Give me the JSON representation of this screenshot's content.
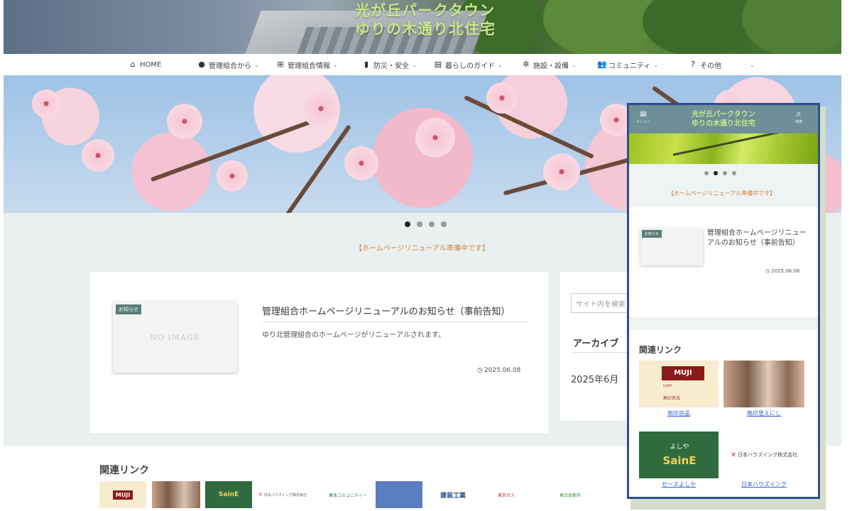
{
  "site": {
    "title_line1": "光が丘パークタウン",
    "title_line2": "ゆりの木通り北住宅"
  },
  "nav": {
    "items": [
      {
        "label": "HOME",
        "icon": "home-icon"
      },
      {
        "label": "管理組合から",
        "icon": "info-icon"
      },
      {
        "label": "管理組合情報",
        "icon": "sitemap-icon"
      },
      {
        "label": "防災・安全",
        "icon": "clipboard-icon"
      },
      {
        "label": "暮らしのガイド",
        "icon": "document-icon"
      },
      {
        "label": "施設・設備",
        "icon": "gear-icon"
      },
      {
        "label": "コミュニティ",
        "icon": "users-icon"
      },
      {
        "label": "その他",
        "icon": "question-icon"
      }
    ],
    "chevron": "⌄"
  },
  "notice": "【ホームページリニューアル準備中です】",
  "post": {
    "category": "お知らせ",
    "noimage": "NO IMAGE",
    "title": "管理組合ホームページリニューアルのお知らせ（事前告知）",
    "excerpt": "ゆり北管理組合のホームページがリニューアルされます。",
    "date": "2025.06.08"
  },
  "sidebar": {
    "search_placeholder": "サイト内を検索",
    "archive_heading": "アーカイブ",
    "archive_item": "2025年6月"
  },
  "links": {
    "heading": "関連リンク",
    "logos": [
      {
        "label": "MUJI"
      },
      {
        "label": ""
      },
      {
        "label": "SainE"
      },
      {
        "label": "日本ハウズイング株式会社"
      },
      {
        "label": "東急コミュニティー"
      },
      {
        "label": ""
      },
      {
        "label": "建装工業"
      },
      {
        "label": "東京ガス"
      },
      {
        "label": "東日本都市"
      }
    ]
  },
  "mobile": {
    "menu_label": "メニュー",
    "search_label": "検索",
    "title_line1": "光が丘パークタウン",
    "title_line2": "ゆりの木通り北住宅",
    "notice": "【ホームページリニューアル準備中です】",
    "post_category": "お知らせ",
    "post_title": "管理組合ホームページリニューアルのお知らせ（事前告知）",
    "post_date": "2025.06.08",
    "links_heading": "関連リンク",
    "link_tiles": [
      {
        "label": "無印良品",
        "logo_text": "MUJI"
      },
      {
        "label": "無印里えにし",
        "logo_text": ""
      },
      {
        "label": "セーヌよしや",
        "logo_text": "SainE"
      },
      {
        "label": "日本ハウズイング",
        "logo_text": "日本ハウズイング株式会社"
      }
    ],
    "muji_sub": "com",
    "muji_sub2": "無印良品",
    "saine_top": "よしや"
  },
  "slider": {
    "count": 4,
    "active": 1
  }
}
